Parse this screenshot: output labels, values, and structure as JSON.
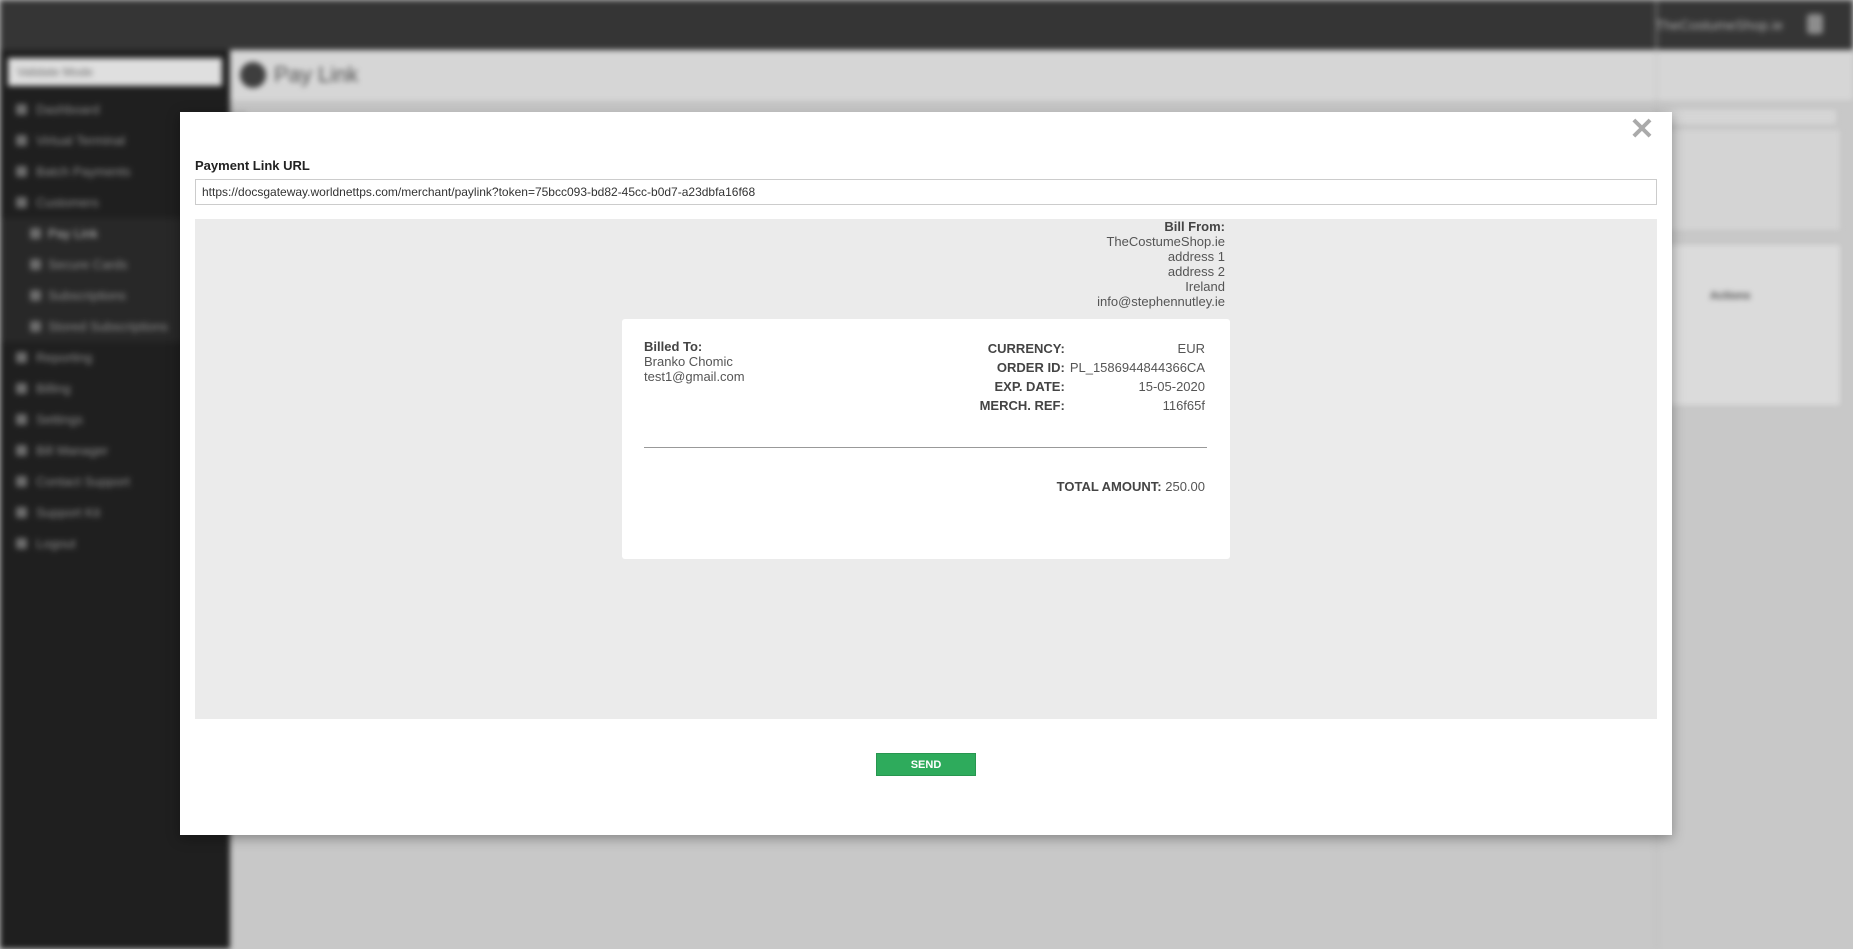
{
  "background": {
    "topbar": {
      "shop_name": "TheCostumeShop.ie"
    },
    "sidebar": {
      "selector_value": "Validate Mode",
      "items": [
        {
          "label": "Dashboard"
        },
        {
          "label": "Virtual Terminal"
        },
        {
          "label": "Batch Payments"
        },
        {
          "label": "Customers"
        },
        {
          "label": "Pay Link",
          "sub": true,
          "active": true
        },
        {
          "label": "Secure Cards",
          "sub": true
        },
        {
          "label": "Subscriptions",
          "sub": true
        },
        {
          "label": "Stored Subscriptions",
          "sub": true
        },
        {
          "label": "Reporting"
        },
        {
          "label": "Billing"
        },
        {
          "label": "Settings"
        },
        {
          "label": "Bill Manager"
        },
        {
          "label": "Contact Support"
        },
        {
          "label": "Support Kit"
        },
        {
          "label": "Logout"
        }
      ]
    },
    "page_title": "Pay Link",
    "right_card_label": "Actions"
  },
  "modal": {
    "url_label": "Payment Link URL",
    "url_value": "https://docsgateway.worldnettps.com/merchant/paylink?token=75bcc093-bd82-45cc-b0d7-a23dbfa16f68",
    "bill_from": {
      "heading": "Bill From:",
      "company": "TheCostumeShop.ie",
      "address1": "address 1",
      "address2": "address 2",
      "country": "Ireland",
      "email": "info@stephennutley.ie"
    },
    "billed_to": {
      "heading": "Billed To:",
      "name": "Branko Chomic",
      "email": "test1@gmail.com"
    },
    "details": {
      "currency_label": "CURRENCY:",
      "currency": "EUR",
      "order_label": "ORDER ID:",
      "order_id": "PL_1586944844366CA",
      "exp_label": "EXP. DATE:",
      "exp_date": "15-05-2020",
      "ref_label": "MERCH. REF:",
      "merch_ref": "116f65f"
    },
    "total": {
      "label": "TOTAL AMOUNT:",
      "amount": "250.00"
    },
    "send_label": "SEND"
  }
}
